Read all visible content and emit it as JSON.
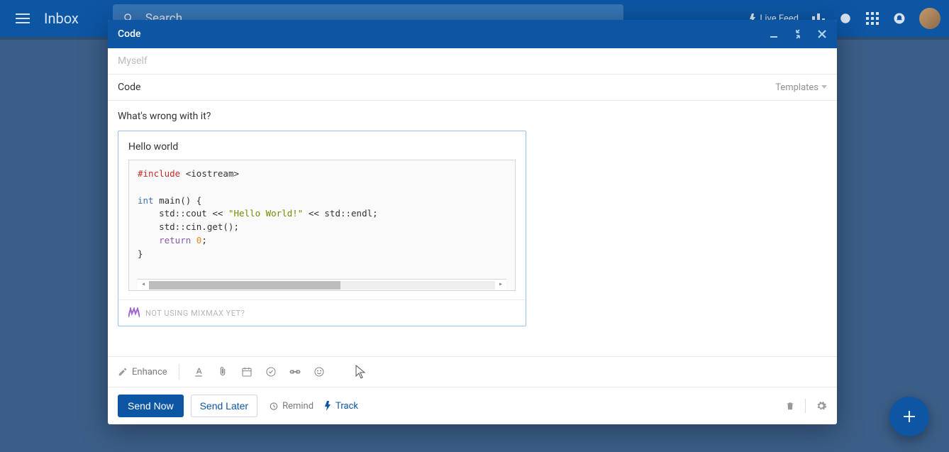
{
  "app": {
    "section": "Inbox",
    "search_placeholder": "Search",
    "live_feed": "Live Feed"
  },
  "compose": {
    "window_title": "Code",
    "to_placeholder": "Myself",
    "subject": "Code",
    "templates_label": "Templates",
    "body_question": "What's wrong with it?",
    "snippet": {
      "title": "Hello world",
      "code_lines": [
        {
          "t": "include",
          "text": "#include"
        },
        {
          "t": "plain",
          "text": " <iostream>\n\n"
        },
        {
          "t": "type",
          "text": "int"
        },
        {
          "t": "plain",
          "text": " main() {\n    std::cout << "
        },
        {
          "t": "string",
          "text": "\"Hello World!\""
        },
        {
          "t": "plain",
          "text": " << std::endl;\n    std::cin.get();\n    "
        },
        {
          "t": "return",
          "text": "return"
        },
        {
          "t": "plain",
          "text": " "
        },
        {
          "t": "num",
          "text": "0"
        },
        {
          "t": "plain",
          "text": ";\n}"
        }
      ],
      "mixmax_promo": "NOT USING MIXMAX YET?"
    }
  },
  "toolbar": {
    "enhance": "Enhance"
  },
  "footer": {
    "send_now": "Send Now",
    "send_later": "Send Later",
    "remind": "Remind",
    "track": "Track"
  }
}
